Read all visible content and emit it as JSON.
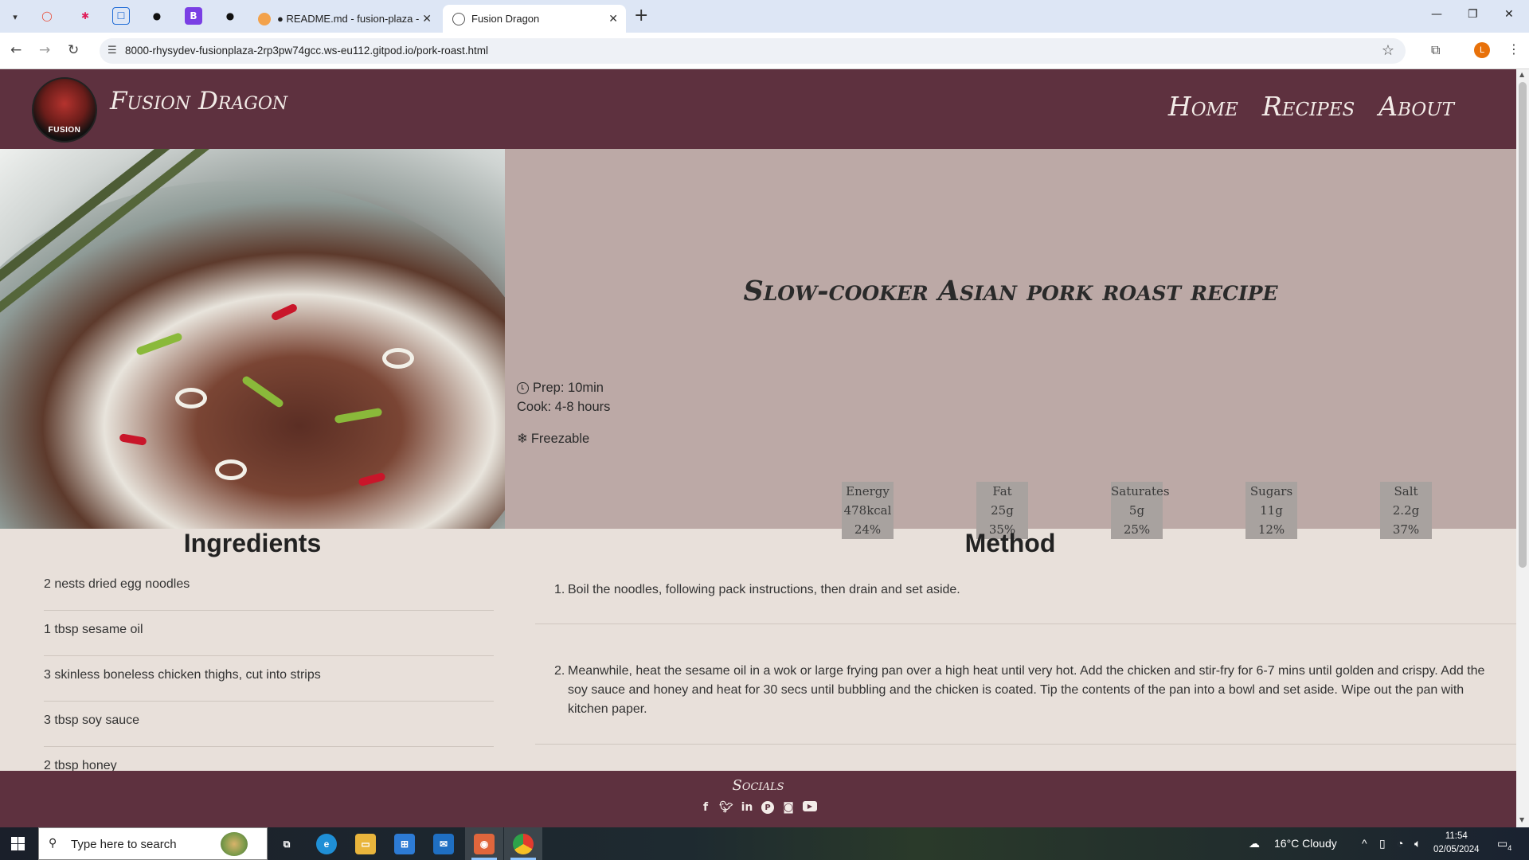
{
  "browser": {
    "tabs": [
      {
        "title": "● README.md - fusion-plaza -",
        "active": false
      },
      {
        "title": "Fusion Dragon",
        "active": true
      }
    ],
    "url": "8000-rhysydev-fusionplaza-2rp3pw74gcc.ws-eu112.gitpod.io/pork-roast.html",
    "profile_initial": "L"
  },
  "site": {
    "brand": "Fusion Dragon",
    "logo_text": "FUSION",
    "nav": [
      "Home",
      "Recipes",
      "About"
    ]
  },
  "recipe": {
    "title": "Slow-cooker Asian pork roast recipe",
    "prep": "Prep: 10min",
    "cook": "Cook: 4-8 hours",
    "freezable": "Freezable",
    "nutrition": [
      {
        "name": "Energy",
        "amount": "478kcal",
        "percent": "24%"
      },
      {
        "name": "Fat",
        "amount": "25g",
        "percent": "35%"
      },
      {
        "name": "Saturates",
        "amount": "5g",
        "percent": "25%"
      },
      {
        "name": "Sugars",
        "amount": "11g",
        "percent": "12%"
      },
      {
        "name": "Salt",
        "amount": "2.2g",
        "percent": "37%"
      }
    ],
    "ingredients_heading": "Ingredients",
    "ingredients": [
      "2 nests dried egg noodles",
      "1 tbsp sesame oil",
      "3 skinless boneless chicken thighs, cut into strips",
      "3 tbsp soy sauce",
      "2 tbsp honey"
    ],
    "method_heading": "Method",
    "method": [
      {
        "num": "1.",
        "text": "Boil the noodles, following pack instructions, then drain and set aside."
      },
      {
        "num": "2.",
        "text": "Meanwhile, heat the sesame oil in a wok or large frying pan over a high heat until very hot. Add the chicken and stir-fry for 6-7 mins until golden and crispy. Add the soy sauce and honey and heat for 30 secs until bubbling and the chicken is coated. Tip the contents of the pan into a bowl and set aside. Wipe out the pan with kitchen paper."
      }
    ]
  },
  "footer": {
    "socials_heading": "Socials",
    "icons": [
      "facebook-icon",
      "twitter-icon",
      "linkedin-icon",
      "pinterest-icon",
      "instagram-icon",
      "youtube-icon"
    ]
  },
  "taskbar": {
    "search_placeholder": "Type here to search",
    "weather": "16°C  Cloudy",
    "time": "11:54",
    "date": "02/05/2024",
    "notifications": "4"
  }
}
